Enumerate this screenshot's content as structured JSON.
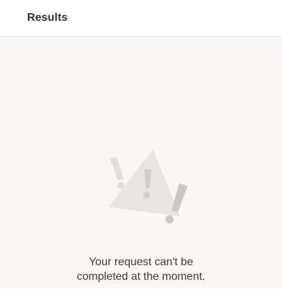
{
  "header": {
    "title": "Results"
  },
  "empty_state": {
    "illustration_icon": "warning-triangle-icon",
    "message_line1": "Your request can't be",
    "message_line2": "completed at the moment."
  },
  "colors": {
    "background": "#f8f7f6",
    "header_text": "#323130",
    "message_text": "#3b3a39",
    "illustration_light": "#e6e5e4",
    "illustration_mid": "#cfcecd",
    "illustration_dark": "#bdbcbb"
  }
}
